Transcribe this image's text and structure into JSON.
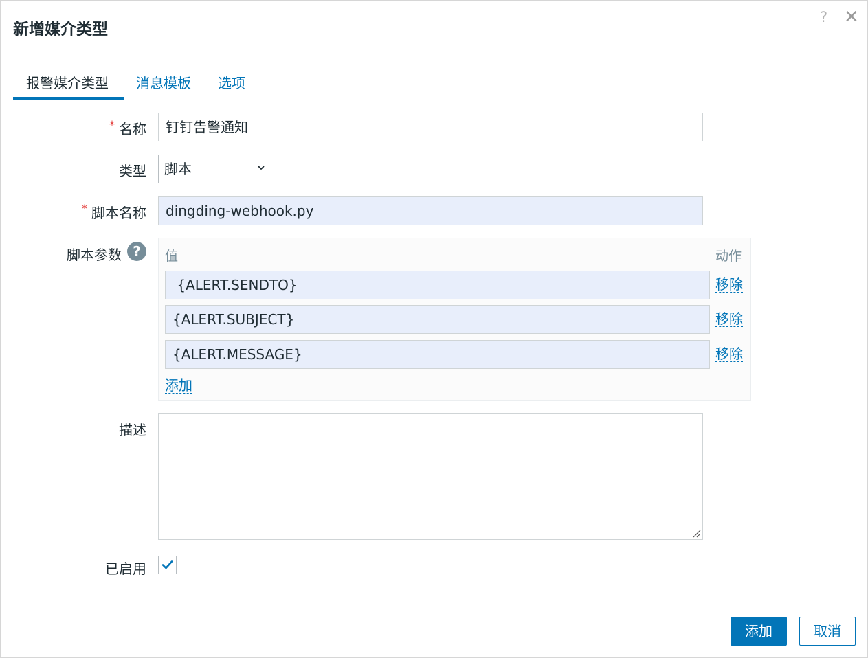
{
  "dialog": {
    "title": "新增媒介类型",
    "help_label": "?",
    "close_label": "✕"
  },
  "tabs": [
    {
      "label": "报警媒介类型",
      "active": true
    },
    {
      "label": "消息模板",
      "active": false
    },
    {
      "label": "选项",
      "active": false
    }
  ],
  "form": {
    "required_mark": "*",
    "name": {
      "label": "名称",
      "value": "钉钉告警通知"
    },
    "type": {
      "label": "类型",
      "selected": "脚本"
    },
    "script_name": {
      "label": "脚本名称",
      "value": "dingding-webhook.py"
    },
    "script_params": {
      "label": "脚本参数",
      "help_icon": "?",
      "col_value": "值",
      "col_action": "动作",
      "rows": [
        {
          "value": " {ALERT.SENDTO}",
          "action": "移除"
        },
        {
          "value": "{ALERT.SUBJECT}",
          "action": "移除"
        },
        {
          "value": "{ALERT.MESSAGE}",
          "action": "移除"
        }
      ],
      "add_label": "添加"
    },
    "description": {
      "label": "描述",
      "value": ""
    },
    "enabled": {
      "label": "已启用",
      "checked": true
    }
  },
  "footer": {
    "add_button": "添加",
    "cancel_button": "取消"
  },
  "colors": {
    "accent": "#0275b8",
    "required": "#e33734",
    "filled_input": "#e8eefb"
  }
}
